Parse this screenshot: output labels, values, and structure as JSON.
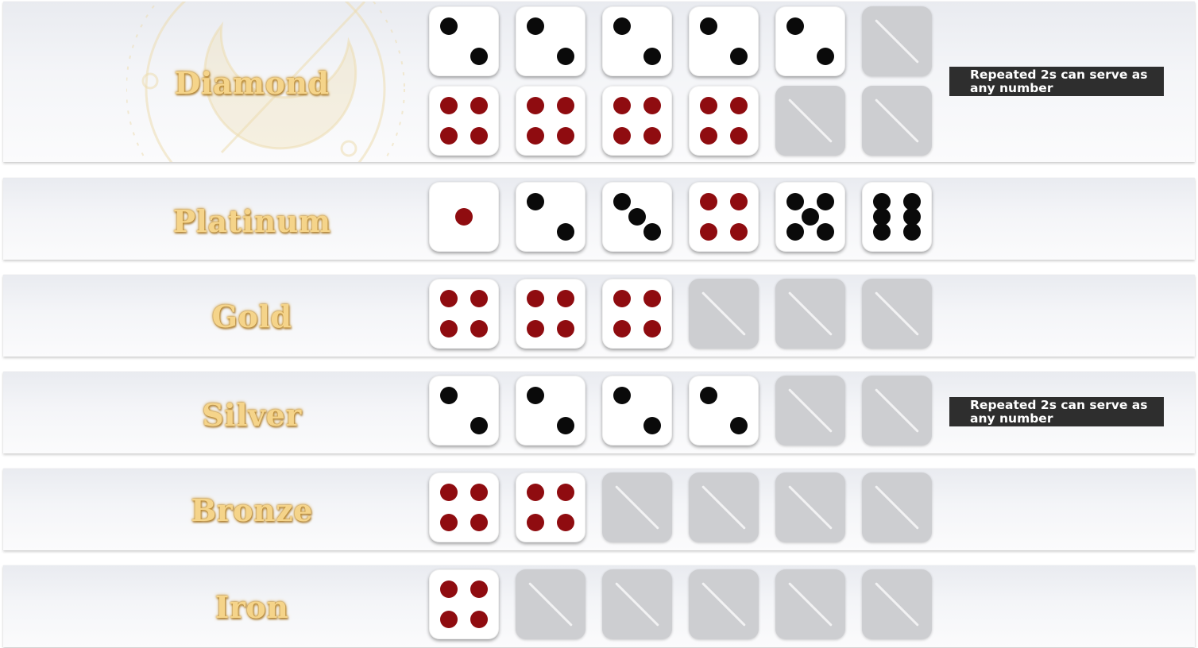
{
  "tiers": [
    {
      "name": "Diamond",
      "note": "Repeated 2s can serve as any number",
      "dice": [
        [
          2,
          2,
          2,
          2,
          2,
          0
        ],
        [
          4,
          4,
          4,
          4,
          0,
          0
        ]
      ]
    },
    {
      "name": "Platinum",
      "note": "",
      "dice": [
        [
          1,
          2,
          3,
          4,
          5,
          6
        ]
      ]
    },
    {
      "name": "Gold",
      "note": "",
      "dice": [
        [
          4,
          4,
          4,
          0,
          0,
          0
        ]
      ]
    },
    {
      "name": "Silver",
      "note": "Repeated 2s can serve as any number",
      "dice": [
        [
          2,
          2,
          2,
          2,
          0,
          0
        ]
      ]
    },
    {
      "name": "Bronze",
      "note": "",
      "dice": [
        [
          4,
          4,
          0,
          0,
          0,
          0
        ]
      ]
    },
    {
      "name": "Iron",
      "note": "",
      "dice": [
        [
          4,
          0,
          0,
          0,
          0,
          0
        ]
      ]
    }
  ],
  "colors": {
    "pip_black": "#0a0a0a",
    "pip_red": "#8f0c10",
    "blank_die": "#cdced1",
    "label_gold": "#f5d48a",
    "note_bg": "#2e2e2e"
  },
  "icons": {
    "blank_die": "slash-die-icon",
    "emblem": "crescent-moon-emblem-icon"
  }
}
